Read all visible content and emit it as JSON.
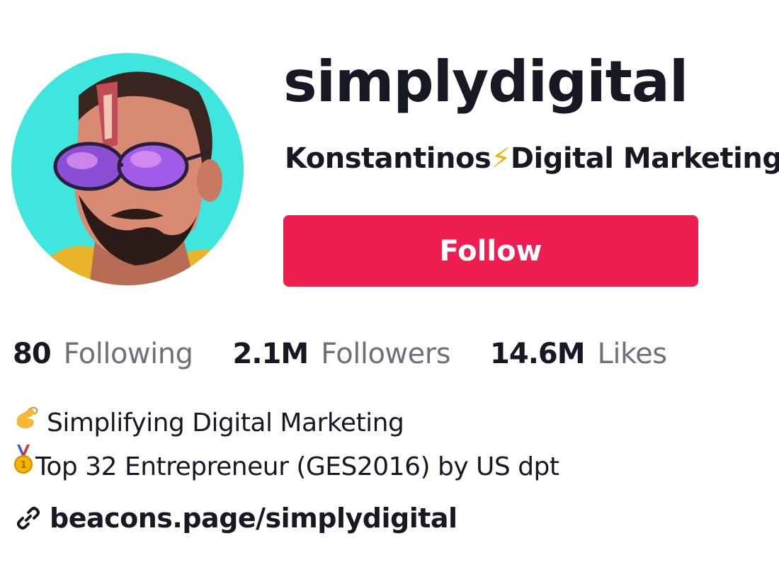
{
  "profile": {
    "username": "simplydigital",
    "nickname_part1": "Konstantinos",
    "nickname_part2": "Digital Marketing",
    "follow_label": "Follow"
  },
  "stats": [
    {
      "value": "80",
      "label": "Following"
    },
    {
      "value": "2.1M",
      "label": "Followers"
    },
    {
      "value": "14.6M",
      "label": "Likes"
    }
  ],
  "bio": {
    "line1": "Simplifying Digital Marketing",
    "line2": "Top 32 Entrepreneur (GES2016) by US dpt"
  },
  "link": {
    "text": "beacons.page/simplydigital"
  },
  "colors": {
    "follow_button": "#ee1d52",
    "text_primary": "#161823",
    "text_secondary": "#6f7079",
    "avatar_background": "#3ee6dd",
    "bolt": "#f2b20b"
  },
  "icons": {
    "nickname_separator": "lightning-bolt-icon",
    "bio_line1": "pinching-hand-icon",
    "bio_line2": "medal-icon",
    "link": "link-icon"
  }
}
